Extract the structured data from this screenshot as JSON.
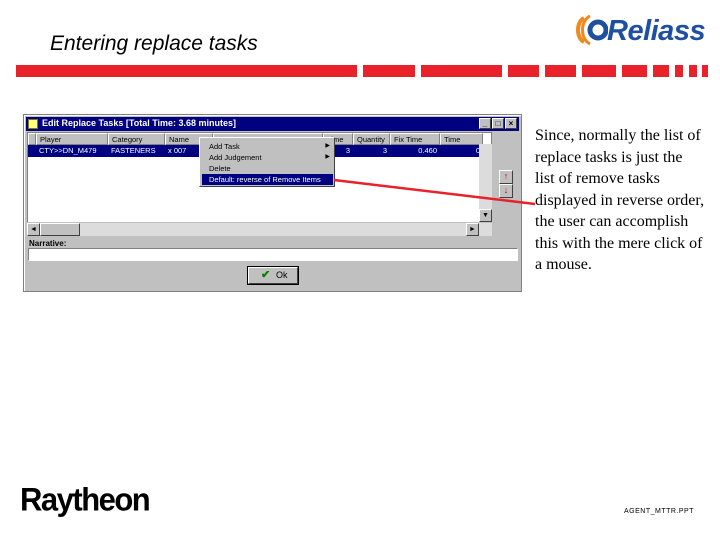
{
  "slide": {
    "title": "Entering replace tasks",
    "caption": "Since, normally the list of replace tasks is just the list of remove tasks displayed in reverse order, the user can accomplish this with the mere click of a mouse.",
    "footer_code": "AGENT_MTTR.PPT"
  },
  "logos": {
    "top_right_word": "Reliass",
    "bottom_left_word": "Raytheon"
  },
  "colors": {
    "accent_red": "#e8212b",
    "reliass_blue": "#1f4fa0",
    "reliass_orange": "#f08a1c",
    "win_title": "#000080"
  },
  "window": {
    "title": "Edit Replace Tasks [Total Time: 3.68 minutes]",
    "buttons": {
      "minimize": "_",
      "maximize": "□",
      "close": "×"
    },
    "columns": [
      "Player",
      "Category",
      "Name",
      "...",
      "Time",
      "Quantity",
      "Fix Time",
      "Time"
    ],
    "rows": [
      {
        "cells": [
          "CTY>>DN_M479",
          "FASTENERS",
          "x 007",
          "",
          "",
          "3",
          "3",
          "0.460",
          "0"
        ]
      }
    ],
    "context_menu": [
      {
        "label": "Add Task",
        "submenu": true,
        "selected": false
      },
      {
        "label": "Add Judgement",
        "submenu": true,
        "selected": false
      },
      {
        "label": "Delete",
        "submenu": false,
        "selected": false
      },
      {
        "label": "Default: reverse of Remove Items",
        "submenu": false,
        "selected": true
      }
    ],
    "narrative_label": "Narrative:",
    "narrative_value": "",
    "ok_label": "Ok",
    "order_buttons": {
      "up": "↑",
      "down": "↓"
    }
  },
  "icons": {
    "app": "window-app-icon",
    "ok": "check-icon",
    "up": "up-arrow-icon",
    "down": "down-arrow-icon"
  }
}
